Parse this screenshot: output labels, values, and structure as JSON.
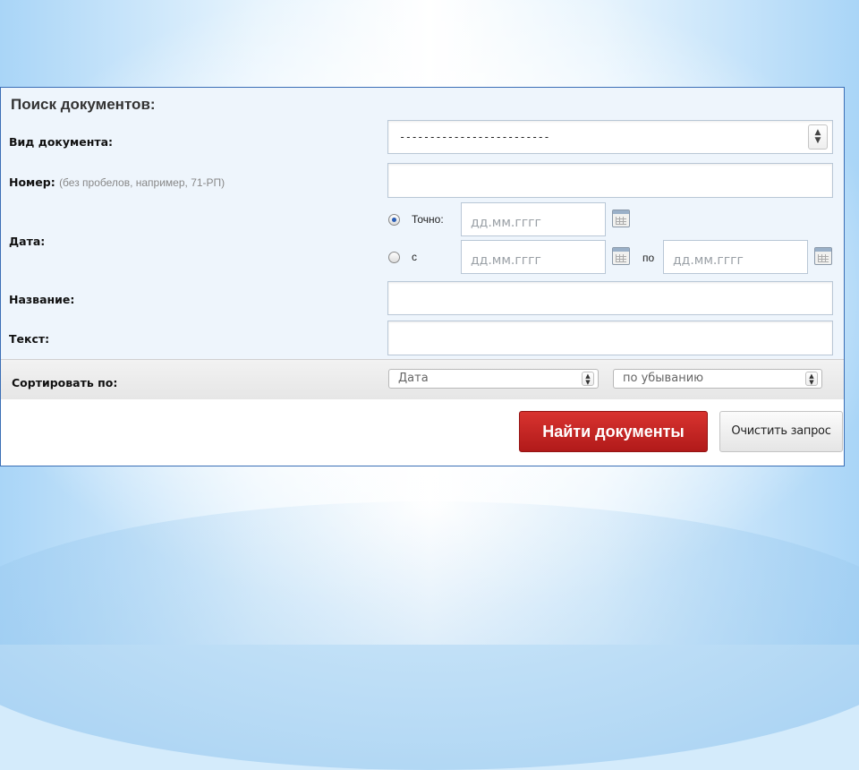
{
  "form": {
    "title": "Поиск документов:",
    "doc_type": {
      "label": "Вид документа:",
      "value": "-------------------------"
    },
    "number": {
      "label": "Номер:",
      "hint": "(без пробелов, например, 71-РП)",
      "value": ""
    },
    "date": {
      "label": "Дата:",
      "exact_label": "Точно:",
      "from_label": "с",
      "to_label": "по",
      "selected": "exact",
      "placeholder": "дд.мм.гггг"
    },
    "name": {
      "label": "Название:",
      "value": ""
    },
    "text": {
      "label": "Текст:",
      "value": ""
    },
    "sort": {
      "label": "Сортировать по:",
      "field": "Дата",
      "order": "по убыванию"
    },
    "buttons": {
      "search": "Найти документы",
      "clear": "Очистить запрос"
    }
  },
  "colors": {
    "accent_red": "#c0201e",
    "panel_border": "#3b6fb6"
  }
}
